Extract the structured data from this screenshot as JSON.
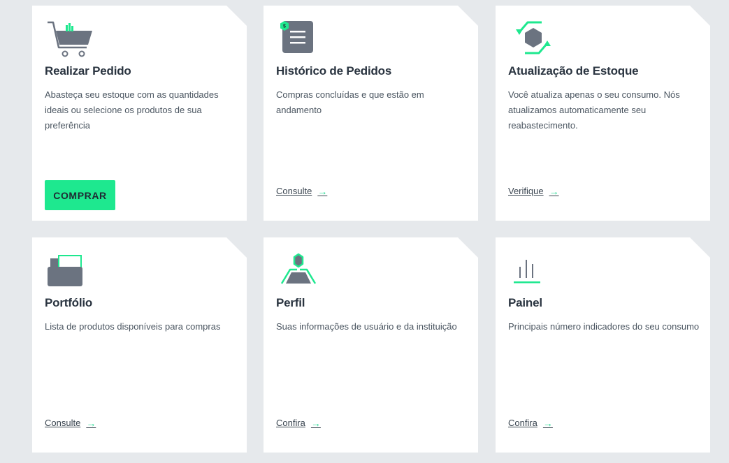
{
  "colors": {
    "accent": "#1ee88f",
    "icon_gray": "#6b7380",
    "background": "#e6e9ec",
    "card": "#ffffff"
  },
  "cards": [
    {
      "icon": "shopping-cart-icon",
      "title": "Realizar Pedido",
      "description": "Abasteça seu estoque com as quantidades ideais ou selecione os produtos de sua preferência",
      "action_label": "COMPRAR"
    },
    {
      "icon": "order-history-icon",
      "title": "Histórico de Pedidos",
      "description": "Compras concluídas e que estão em andamento",
      "link_label": "Consulte",
      "link_arrow": "→",
      "icon_badge": "$"
    },
    {
      "icon": "stock-refresh-icon",
      "title": "Atualização de Estoque",
      "description": "Você atualiza apenas o seu consumo. Nós atualizamos automaticamente seu reabastecimento.",
      "link_label": "Verifique",
      "link_arrow": "→"
    },
    {
      "icon": "folder-icon",
      "title": "Portfólio",
      "description": "Lista de produtos disponíveis para compras",
      "link_label": "Consulte",
      "link_arrow": "→"
    },
    {
      "icon": "user-profile-icon",
      "title": "Perfil",
      "description": "Suas informações de usuário e da instituição",
      "link_label": "Confira",
      "link_arrow": "→"
    },
    {
      "icon": "dashboard-chart-icon",
      "title": "Painel",
      "description": "Principais número indicadores do seu consumo",
      "link_label": "Confira",
      "link_arrow": "→"
    }
  ]
}
